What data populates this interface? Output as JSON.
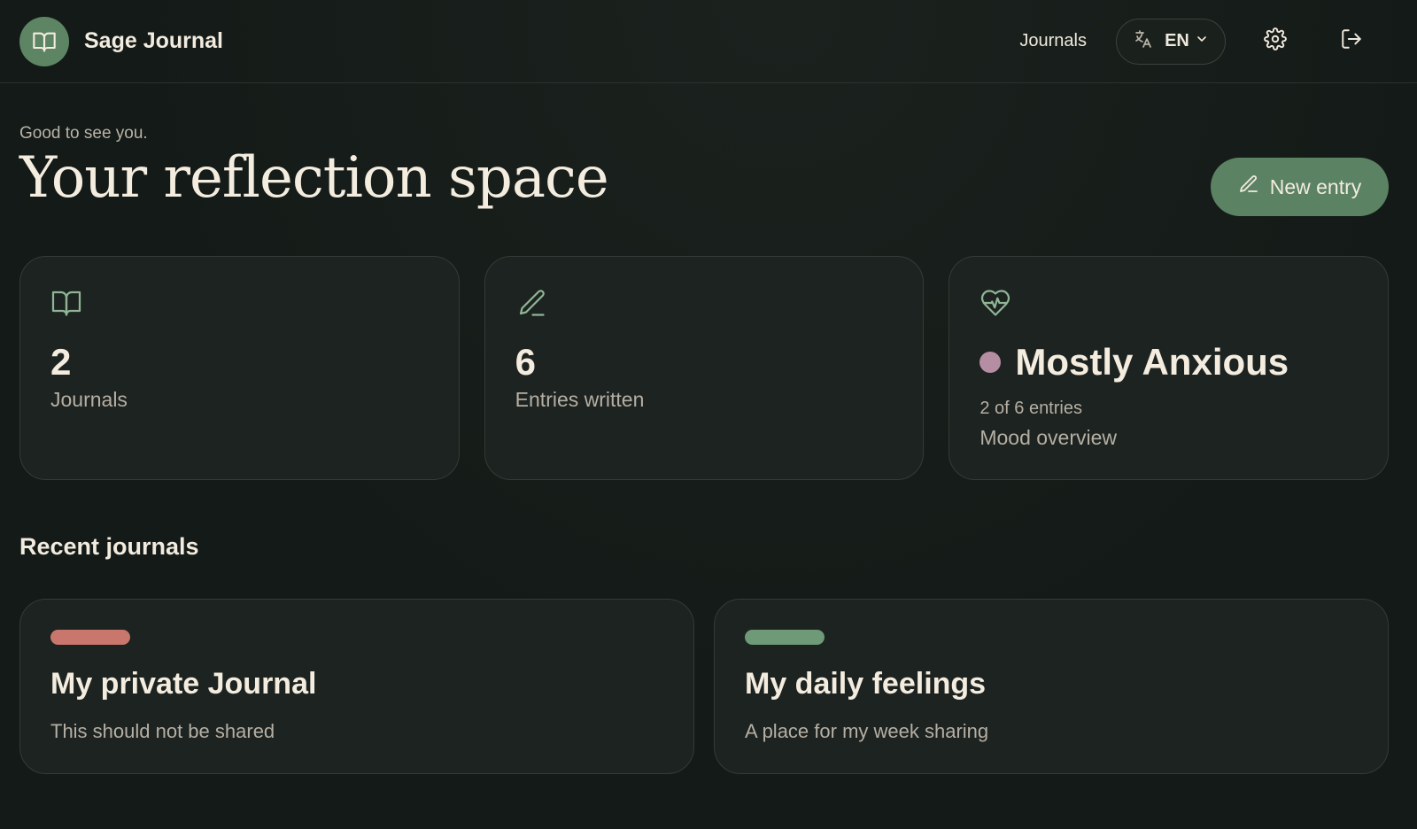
{
  "app": {
    "name": "Sage Journal",
    "logo_icon": "book-open-icon"
  },
  "nav": {
    "journals_label": "Journals",
    "language": {
      "selected": "EN",
      "icon": "translate-icon"
    },
    "settings_icon": "gear-icon",
    "logout_icon": "logout-icon"
  },
  "hero": {
    "greeting": "Good to see you.",
    "title": "Your reflection space",
    "new_entry_label": "New entry"
  },
  "stats": {
    "journals": {
      "value": "2",
      "label": "Journals"
    },
    "entries": {
      "value": "6",
      "label": "Entries written"
    },
    "mood": {
      "title": "Mostly Anxious",
      "sub": "2 of 6 entries",
      "label": "Mood overview",
      "dot_color": "#b58ea4"
    }
  },
  "recent": {
    "title": "Recent journals",
    "items": [
      {
        "name": "My private Journal",
        "description": "This should not be shared",
        "color": "#c9776c"
      },
      {
        "name": "My daily feelings",
        "description": "A place for my week sharing",
        "color": "#6e9a77"
      }
    ]
  },
  "colors": {
    "accent": "#5a8263",
    "icon_accent": "#8fb596",
    "background": "#141a17"
  }
}
